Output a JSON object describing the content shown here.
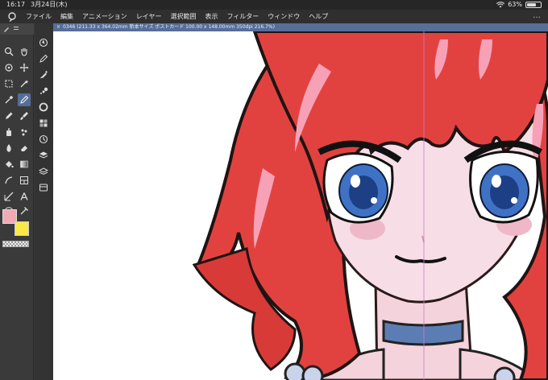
{
  "status": {
    "time": "16:17",
    "date": "3月24日(木)",
    "battery": "63%"
  },
  "menu": [
    "ファイル",
    "編集",
    "アニメーション",
    "レイヤー",
    "選択範囲",
    "表示",
    "フィルター",
    "ウィンドウ",
    "ヘルプ"
  ],
  "more": "…",
  "document": {
    "close": "×",
    "title": "0346 (211.33 x 364.02mm 新本サイズ ポストカード 100.00 x 148.00mm 350dpi 216.7%)"
  },
  "colors": {
    "main": "#f1a9b3",
    "sub": "#fce74a",
    "accent": "#546e96"
  }
}
